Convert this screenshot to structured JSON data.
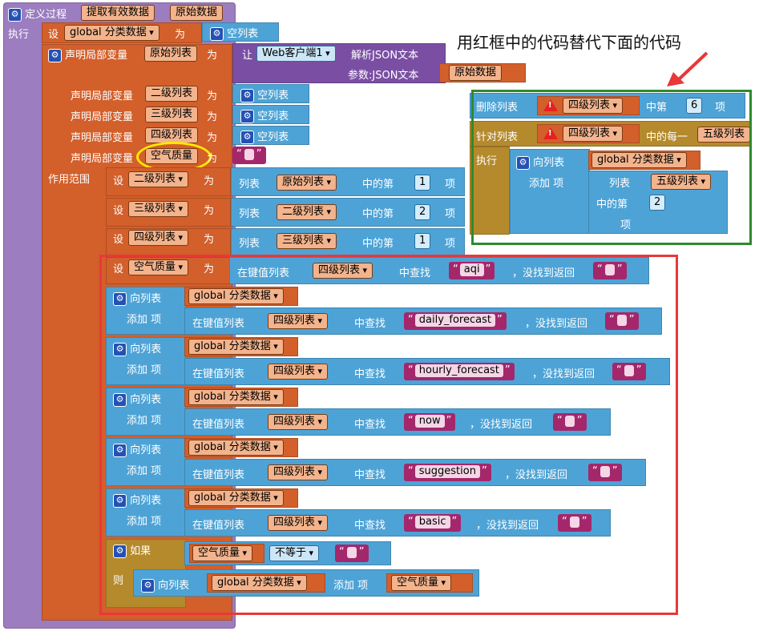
{
  "procedure": {
    "define_label": "定义过程",
    "name": "提取有效数据",
    "param": "原始数据",
    "execute_label": "执行"
  },
  "labels": {
    "set": "设",
    "as": "为",
    "global_var": "global 分类数据",
    "empty_list": "空列表",
    "declare_local": "声明局部变量",
    "let": "让",
    "web_component": "Web客户端1",
    "parse_json": "解析JSON文本",
    "param_json": "参数:JSON文本",
    "scope": "作用范围",
    "list": "列表",
    "nth_of": "中的第",
    "item": "项",
    "in_kv_list": "在键值列表",
    "find": "中查找",
    "not_found_return": "，没找到返回",
    "to_list": "向列表",
    "add_item": "添加  项",
    "add_item_short": "添加",
    "item_short": "项",
    "if": "如果",
    "then": "则",
    "not_equal": "不等于",
    "remove_list": "删除列表",
    "index": "中第",
    "for_list": "针对列表",
    "each": "中的每一",
    "do": "执行",
    "list_word": "列表",
    "nth_item": "中的第",
    "item_word": "项"
  },
  "vars": {
    "raw_list": "原始列表",
    "list2": "二级列表",
    "list3": "三级列表",
    "list4": "四级列表",
    "list5": "五级列表",
    "air_quality": "空气质量",
    "raw_data": "原始数据"
  },
  "numbers": {
    "n1": "1",
    "n2": "2",
    "n6": "6"
  },
  "keys": {
    "aqi": "aqi",
    "daily": "daily_forecast",
    "hourly": "hourly_forecast",
    "now": "now",
    "suggestion": "suggestion",
    "basic": "basic"
  },
  "annotation": {
    "text": "用红框中的代码替代下面的代码"
  },
  "colors": {
    "procedure": "#9b7dc0",
    "variable": "#d35f2a",
    "list": "#4ea3d6",
    "control": "#b58a2d",
    "text": "#a4276b",
    "red_frame": "#e83838",
    "green_frame": "#2d8a2d",
    "yellow_circle": "#ffea00"
  }
}
